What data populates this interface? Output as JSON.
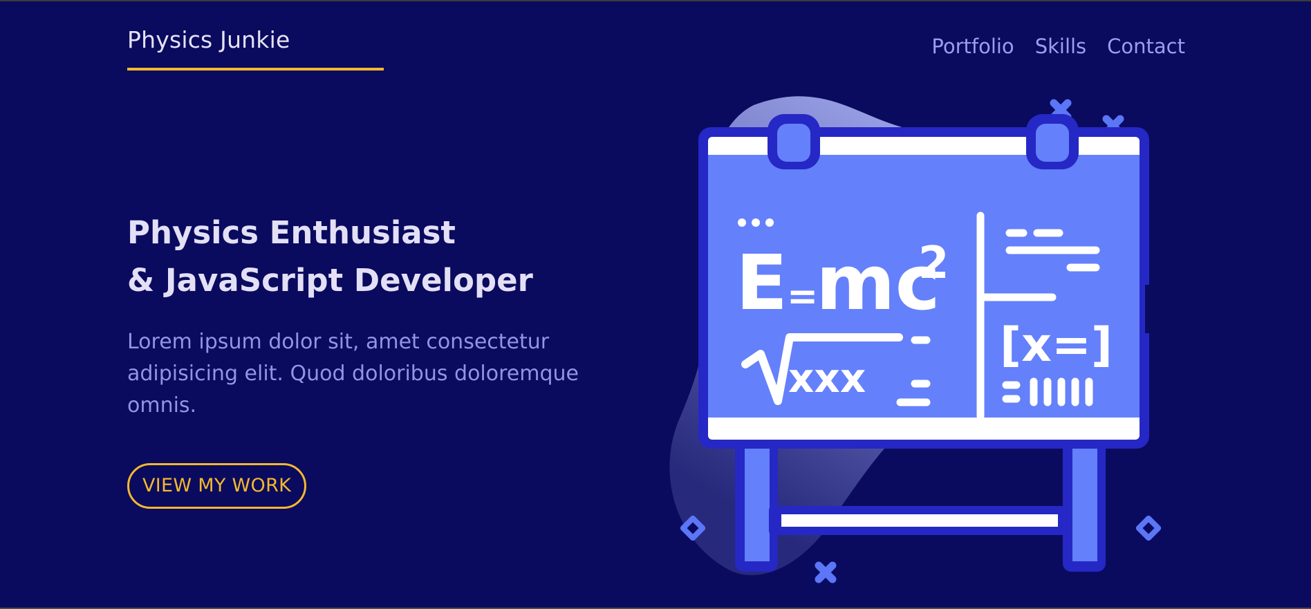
{
  "brand": {
    "name": "Physics Junkie"
  },
  "nav": {
    "items": [
      {
        "label": "Portfolio"
      },
      {
        "label": "Skills"
      },
      {
        "label": "Contact"
      }
    ]
  },
  "hero": {
    "headline_line1": "Physics Enthusiast",
    "headline_line2": "& JavaScript Developer",
    "description": "Lorem ipsum dolor sit, amet consectetur adipisicing elit. Quod doloribus doloremque omnis.",
    "cta_label": "VIEW MY WORK"
  },
  "illustration": {
    "formula_base": "E",
    "formula_eq": "=",
    "formula_rest": "mc",
    "formula_exp": "2",
    "root_content": "xxx",
    "bracket_content": "[x=]"
  },
  "colors": {
    "background": "#0a0b5e",
    "accent": "#f5b82e",
    "board": "#6480fb",
    "board_border": "#2528c4"
  }
}
